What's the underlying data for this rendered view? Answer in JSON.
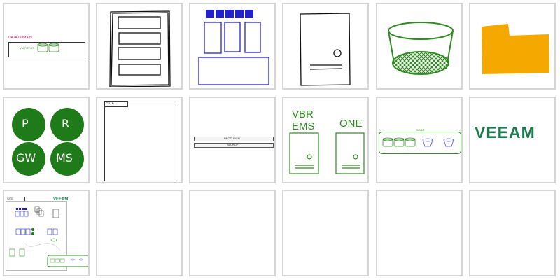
{
  "palette": {
    "green": "#2e8b1f",
    "dark_green": "#1f7a1a",
    "blue": "#2222cc",
    "orange": "#f5a800",
    "magenta": "#c2185b",
    "veeam": "#1d7a4e",
    "border": "#d6d6d6"
  },
  "tiles": {
    "t1": {
      "label": "DATA DOMAIN",
      "sub": "VM FOTOS"
    },
    "t8": {
      "tab": "SITE"
    },
    "t9": {
      "row1": "PROD HIGH",
      "row2": "BACKUP"
    },
    "t10": {
      "title_line1": "VBR",
      "title_line2": "EMS",
      "title2": "ONE"
    },
    "t11": {
      "label": "SOBR"
    },
    "t12": {
      "logo": "VEEAM"
    },
    "t13": {
      "tab": "SITE",
      "logo": "VEEAM"
    }
  },
  "circles": [
    "P",
    "R",
    "GW",
    "MS"
  ]
}
